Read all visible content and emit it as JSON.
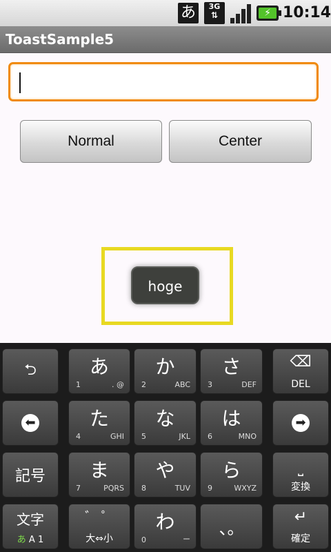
{
  "status_bar": {
    "ime_indicator": "あ",
    "network": "3G",
    "time": "10:14"
  },
  "app": {
    "title": "ToastSample5"
  },
  "form": {
    "text_value": "",
    "normal_button": "Normal",
    "center_button": "Center"
  },
  "toast": {
    "text": "hoge"
  },
  "keyboard": {
    "row1": [
      {
        "main": "あ",
        "num": "1",
        "sub": ". @"
      },
      {
        "main": "か",
        "num": "2",
        "sub": "ABC"
      },
      {
        "main": "さ",
        "num": "3",
        "sub": "DEF"
      }
    ],
    "row2": [
      {
        "main": "た",
        "num": "4",
        "sub": "GHI"
      },
      {
        "main": "な",
        "num": "5",
        "sub": "JKL"
      },
      {
        "main": "は",
        "num": "6",
        "sub": "MNO"
      }
    ],
    "row3": [
      {
        "main": "ま",
        "num": "7",
        "sub": "PQRS"
      },
      {
        "main": "や",
        "num": "8",
        "sub": "TUV"
      },
      {
        "main": "ら",
        "num": "9",
        "sub": "WXYZ"
      }
    ],
    "row4_center": {
      "main": "わ",
      "num": "0",
      "sub": "ー"
    },
    "dakuten_top": "゛ ゜",
    "dakuten_bottom": "大⇔小",
    "punct": "、。",
    "del_label": "DEL",
    "symbol_label": "記号",
    "convert_label": "変換",
    "confirm_label": "確定",
    "mode_label": "文字",
    "mode_sub_active": "あ",
    "mode_sub_rest": "A 1"
  }
}
